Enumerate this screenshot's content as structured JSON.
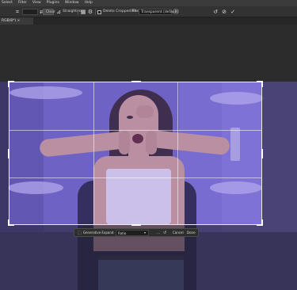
{
  "menubar": {
    "items": [
      "Select",
      "Filter",
      "View",
      "Plugins",
      "Window",
      "Help"
    ]
  },
  "options": {
    "ratio_value": "",
    "clear_label": "Clear",
    "straighten_label": "Straighten",
    "delete_label": "Delete Cropped Pixels",
    "fill_label": "Fill",
    "fill_value": "Transparent (default)",
    "icons": [
      "crop-tool-icon",
      "swap-icon",
      "grid-overlay-icon",
      "settings-gear-icon",
      "reset-icon",
      "cancel-icon",
      "commit-check-icon"
    ]
  },
  "document": {
    "tab_label": "RGB/8*) ×"
  },
  "taskbar": {
    "generative_label": "Generative Expand",
    "ratio_label": "Ratio",
    "more_label": "…",
    "cancel_label": "Cancel",
    "done_label": "Done"
  },
  "colors": {
    "crop_border": "#eaeaea",
    "overlay_tint": "#7864e6"
  }
}
